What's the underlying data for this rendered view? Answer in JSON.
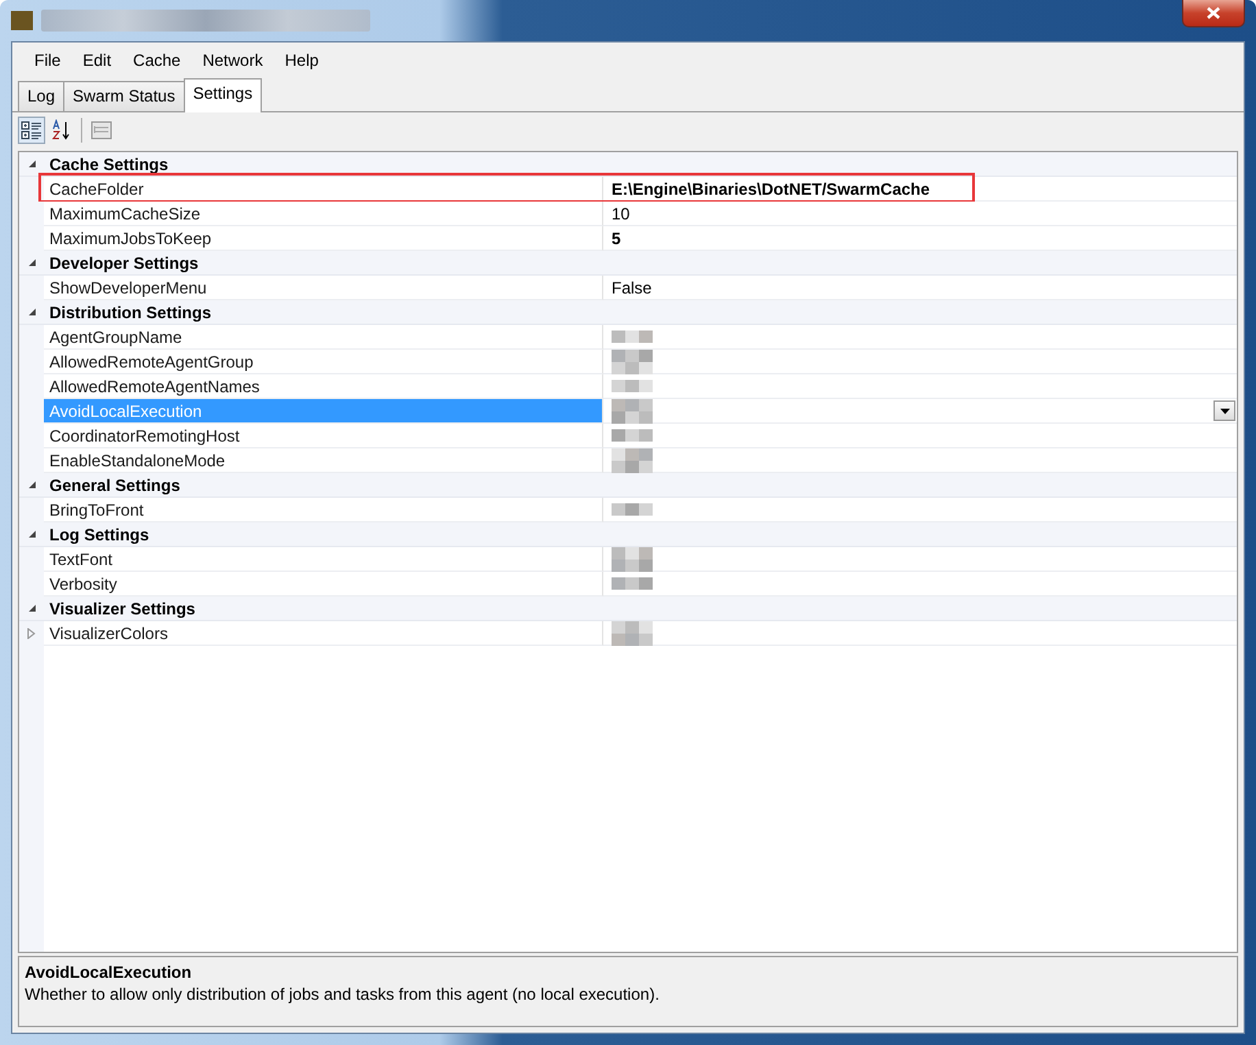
{
  "menu": [
    "File",
    "Edit",
    "Cache",
    "Network",
    "Help"
  ],
  "tabs": [
    {
      "label": "Log",
      "selected": false
    },
    {
      "label": "Swarm Status",
      "selected": false
    },
    {
      "label": "Settings",
      "selected": true
    }
  ],
  "toolbar": [
    {
      "kind": "categorized",
      "selected": true
    },
    {
      "kind": "alphabetical",
      "selected": false
    },
    {
      "kind": "pages",
      "selected": false
    }
  ],
  "categories": [
    {
      "name": "Cache Settings",
      "expanded": true,
      "properties": [
        {
          "name": "CacheFolder",
          "kind": "plain",
          "value": "E:\\Engine\\Binaries\\DotNET/SwarmCache",
          "bold": true,
          "selected": false,
          "highlighted": true
        },
        {
          "name": "MaximumCacheSize",
          "kind": "plain",
          "value": "10",
          "bold": false,
          "selected": false,
          "highlighted": false
        },
        {
          "name": "MaximumJobsToKeep",
          "kind": "plain",
          "value": "5",
          "bold": true,
          "selected": false,
          "highlighted": false
        }
      ]
    },
    {
      "name": "Developer Settings",
      "expanded": true,
      "properties": [
        {
          "name": "ShowDeveloperMenu",
          "kind": "plain",
          "value": "False",
          "bold": false,
          "selected": false,
          "highlighted": false
        }
      ]
    },
    {
      "name": "Distribution Settings",
      "expanded": true,
      "properties": [
        {
          "name": "AgentGroupName",
          "kind": "redacted",
          "selected": false,
          "highlighted": false
        },
        {
          "name": "AllowedRemoteAgentGroup",
          "kind": "redacted",
          "selected": false,
          "highlighted": false
        },
        {
          "name": "AllowedRemoteAgentNames",
          "kind": "redacted",
          "selected": false,
          "highlighted": false
        },
        {
          "name": "AvoidLocalExecution",
          "kind": "redacted",
          "selected": true,
          "highlighted": false
        },
        {
          "name": "CoordinatorRemotingHost",
          "kind": "redacted",
          "selected": false,
          "highlighted": false
        },
        {
          "name": "EnableStandaloneMode",
          "kind": "redacted",
          "selected": false,
          "highlighted": false
        }
      ]
    },
    {
      "name": "General Settings",
      "expanded": true,
      "properties": [
        {
          "name": "BringToFront",
          "kind": "redacted",
          "selected": false,
          "highlighted": false
        }
      ]
    },
    {
      "name": "Log Settings",
      "expanded": true,
      "properties": [
        {
          "name": "TextFont",
          "kind": "redacted",
          "selected": false,
          "highlighted": false
        },
        {
          "name": "Verbosity",
          "kind": "redacted",
          "selected": false,
          "highlighted": false
        }
      ]
    },
    {
      "name": "Visualizer Settings",
      "expanded": true,
      "properties": [
        {
          "name": "VisualizerColors",
          "kind": "redacted-collapsed",
          "selected": false,
          "highlighted": false
        }
      ]
    }
  ],
  "description": {
    "title": "AvoidLocalExecution",
    "text": "Whether to allow only distribution of jobs and tasks from this agent (no local execution)."
  }
}
